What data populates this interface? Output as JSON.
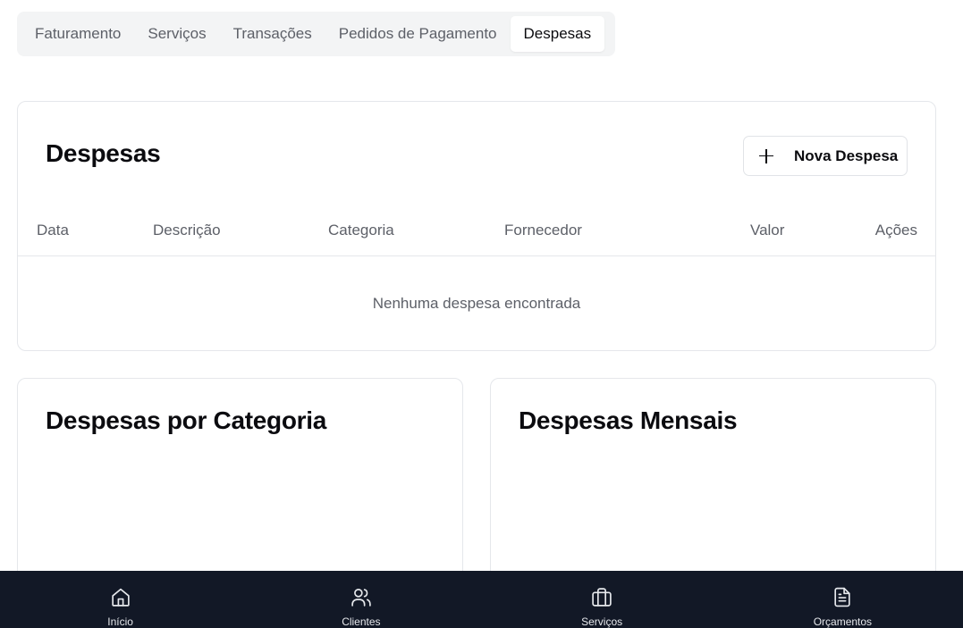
{
  "tabs": [
    {
      "label": "Faturamento",
      "active": false
    },
    {
      "label": "Serviços",
      "active": false
    },
    {
      "label": "Transações",
      "active": false
    },
    {
      "label": "Pedidos de Pagamento",
      "active": false
    },
    {
      "label": "Despesas",
      "active": true
    }
  ],
  "expenses": {
    "title": "Despesas",
    "new_button_label": "Nova Despesa",
    "columns": [
      "Data",
      "Descrição",
      "Categoria",
      "Fornecedor",
      "Valor",
      "Ações"
    ],
    "empty_message": "Nenhuma despesa encontrada"
  },
  "by_category": {
    "title": "Despesas por Categoria"
  },
  "monthly": {
    "title": "Despesas Mensais"
  },
  "bottom_nav": {
    "items": [
      {
        "label": "Início",
        "icon": "home-icon"
      },
      {
        "label": "Clientes",
        "icon": "users-icon"
      },
      {
        "label": "Serviços",
        "icon": "briefcase-icon"
      },
      {
        "label": "Orçamentos",
        "icon": "file-text-icon"
      }
    ]
  },
  "colors": {
    "nav_background": "#121826",
    "tab_bar_background": "#f3f4f5",
    "border": "#e5e7eb",
    "muted_text": "#5d6068"
  }
}
